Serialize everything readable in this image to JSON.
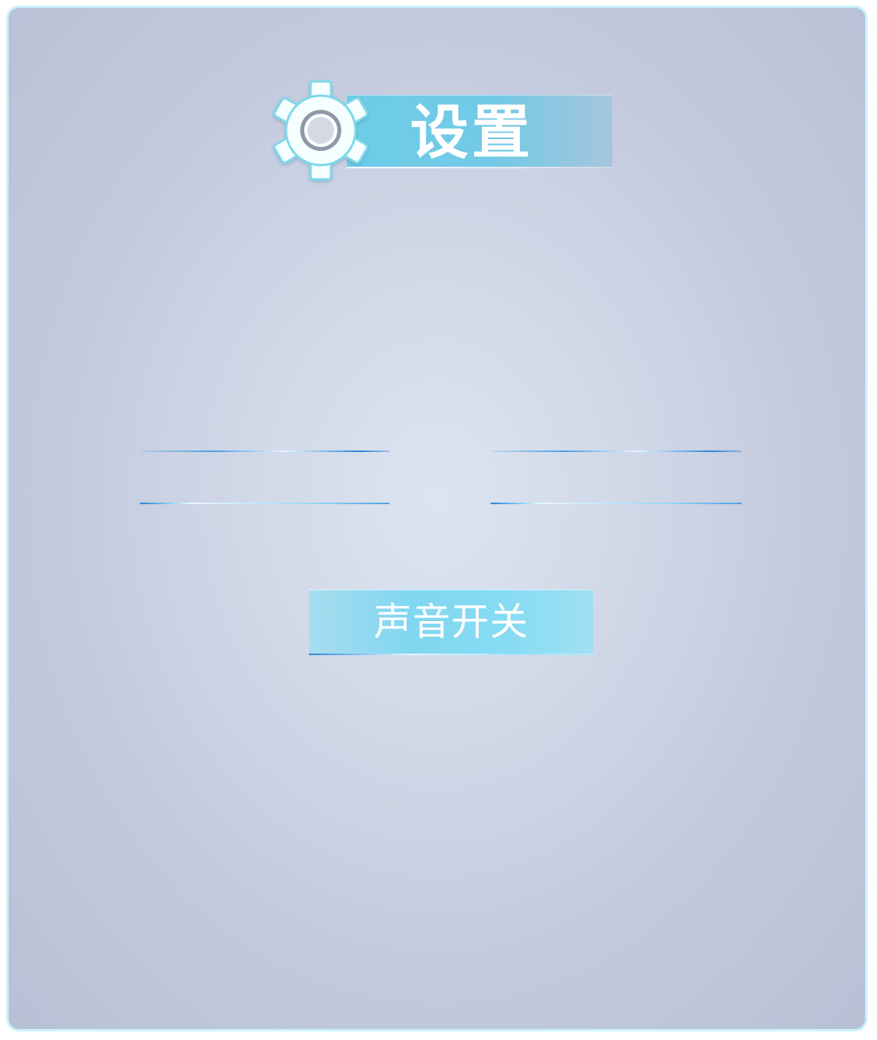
{
  "header": {
    "title": "设置",
    "icon": "gear-icon"
  },
  "controls": {
    "sound_toggle_label": "声音开关"
  },
  "colors": {
    "panel_border": "#c9f1fb",
    "background_center": "#dde4f1",
    "background_edge": "#b7c0d4",
    "title_band": "#6ecde8",
    "button": "#81d7f0",
    "line_accent": "#2f86d8",
    "text": "#ffffff"
  }
}
